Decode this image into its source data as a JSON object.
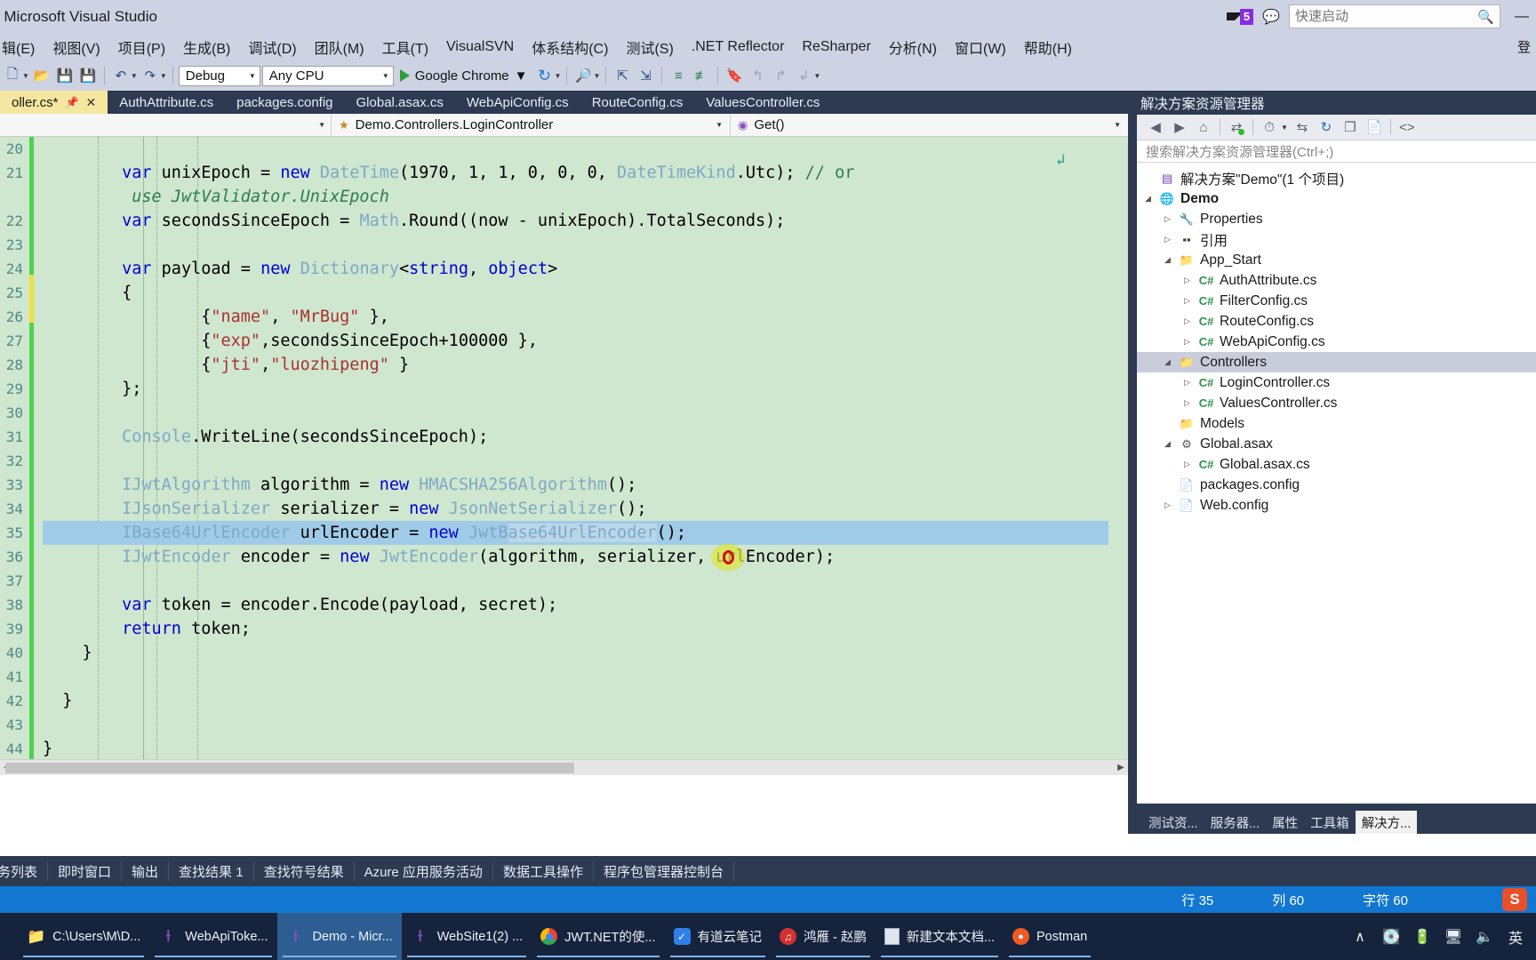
{
  "titlebar": {
    "title": "- Microsoft Visual Studio",
    "quick_launch_placeholder": "快速启动",
    "notification_count": "5",
    "filter_icon": "funnel-icon",
    "feedback_icon": "feedback-icon",
    "search_icon": "search-icon",
    "minimize": "—"
  },
  "menubar": {
    "items": [
      "辑(E)",
      "视图(V)",
      "项目(P)",
      "生成(B)",
      "调试(D)",
      "团队(M)",
      "工具(T)",
      "VisualSVN",
      "体系结构(C)",
      "测试(S)",
      ".NET Reflector",
      "ReSharper",
      "分析(N)",
      "窗口(W)",
      "帮助(H)"
    ],
    "signin": "登"
  },
  "toolbar": {
    "config_value": "Debug",
    "platform_value": "Any CPU",
    "run_label": "Google Chrome",
    "icons": [
      "new-project-icon",
      "open-file-icon",
      "save-icon",
      "save-all-icon",
      "undo-icon",
      "redo-icon",
      "find-icon",
      "navigate-backward-icon",
      "navigate-forward-icon",
      "comment-icon",
      "uncomment-icon",
      "bookmark-icon",
      "prev-bookmark-icon",
      "next-bookmark-icon",
      "clear-bookmark-icon"
    ]
  },
  "editor_tabs": [
    {
      "label": "oller.cs*",
      "active": true,
      "pinned": true,
      "closable": true
    },
    {
      "label": "AuthAttribute.cs",
      "active": false
    },
    {
      "label": "packages.config",
      "active": false
    },
    {
      "label": "Global.asax.cs",
      "active": false
    },
    {
      "label": "WebApiConfig.cs",
      "active": false
    },
    {
      "label": "RouteConfig.cs",
      "active": false
    },
    {
      "label": "ValuesController.cs",
      "active": false
    }
  ],
  "navbar": {
    "type_scope": "Demo.Controllers.LoginController",
    "member_scope": "Get()"
  },
  "code": {
    "first_line_number": 20,
    "selected_line_index": 16,
    "lines": [
      {
        "n": "20",
        "html": ""
      },
      {
        "n": "21",
        "html": "        <span class='kw'>var</span> unixEpoch = <span class='kw'>new</span> <span class='ty'>DateTime</span>(1970, 1, 1, 0, 0, 0, <span class='ty'>DateTimeKind</span>.Utc); <span class='cmt'>// or</span>"
      },
      {
        "n": "",
        "html": "         <span class='cmt-i'>use JwtValidator.UnixEpoch</span>"
      },
      {
        "n": "22",
        "html": "        <span class='kw'>var</span> secondsSinceEpoch = <span class='ty'>Math</span>.Round((now - unixEpoch).TotalSeconds);"
      },
      {
        "n": "23",
        "html": ""
      },
      {
        "n": "24",
        "html": "        <span class='kw'>var</span> payload = <span class='kw'>new</span> <span class='ty'>Dictionary</span>&lt;<span class='kw'>string</span>, <span class='kw'>object</span>&gt;"
      },
      {
        "n": "25",
        "html": "        {"
      },
      {
        "n": "26",
        "html": "                {<span class='str'>\"name\"</span>, <span class='str'>\"MrBug\"</span> },"
      },
      {
        "n": "27",
        "html": "                {<span class='str'>\"exp\"</span>,secondsSinceEpoch+100000 },"
      },
      {
        "n": "28",
        "html": "                {<span class='str'>\"jti\"</span>,<span class='str'>\"luozhipeng\"</span> }"
      },
      {
        "n": "29",
        "html": "        };"
      },
      {
        "n": "30",
        "html": ""
      },
      {
        "n": "31",
        "html": "        <span class='ty'>Console</span>.WriteLine(secondsSinceEpoch);"
      },
      {
        "n": "32",
        "html": ""
      },
      {
        "n": "33",
        "html": "        <span class='ty'>IJwtAlgorithm</span> algorithm = <span class='kw'>new</span> <span class='ty'>HMACSHA256Algorithm</span>();"
      },
      {
        "n": "34",
        "html": "        <span class='ty'>IJsonSerializer</span> serializer = <span class='kw'>new</span> <span class='ty'>JsonNetSerializer</span>();"
      },
      {
        "n": "35",
        "html": "        <span class='ty'>IBase64UrlEncoder</span> urlEncoder = <span class='kw'>new</span> <span class='ty'>JwtB</span><span class='hl-word'><span class='ty'>ase64Url</span></span><span class='hl-word'><span class='ty'>Encoder</span></span>();"
      },
      {
        "n": "36",
        "html": "        <span class='ty'>IJwtEncoder</span> encoder = <span class='kw'>new</span> <span class='ty'>JwtEncoder</span>(algorithm, serializer, urlEncoder);"
      },
      {
        "n": "37",
        "html": ""
      },
      {
        "n": "38",
        "html": "        <span class='kw'>var</span> token = encoder.Encode(payload, secret);"
      },
      {
        "n": "39",
        "html": "        <span class='kw'>return</span> token;"
      },
      {
        "n": "40",
        "html": "    }"
      },
      {
        "n": "41",
        "html": ""
      },
      {
        "n": "42",
        "html": "  }"
      },
      {
        "n": "43",
        "html": ""
      },
      {
        "n": "44",
        "html": "}"
      }
    ]
  },
  "solution_explorer": {
    "title": "解决方案资源管理器",
    "search_placeholder": "搜索解决方案资源管理器(Ctrl+;)",
    "toolbar_icons": [
      "back-icon",
      "forward-icon",
      "home-icon",
      "sync-with-active-document-icon",
      "pending-changes-icon",
      "toggle-icon",
      "refresh-icon",
      "collapse-all-icon",
      "show-all-files-icon",
      "view-code-icon"
    ],
    "tree": [
      {
        "depth": 0,
        "twisty": "",
        "icon": "solution-icon",
        "label": "解决方案\"Demo\"(1 个项目)",
        "bold": false,
        "selected": false
      },
      {
        "depth": 0,
        "twisty": "▲",
        "icon": "project-icon",
        "label": "Demo",
        "bold": true,
        "selected": false
      },
      {
        "depth": 1,
        "twisty": "▶",
        "icon": "properties-icon",
        "label": "Properties",
        "bold": false,
        "selected": false
      },
      {
        "depth": 1,
        "twisty": "▶",
        "icon": "references-icon",
        "label": "引用",
        "bold": false,
        "selected": false
      },
      {
        "depth": 1,
        "twisty": "▲",
        "icon": "folder-icon",
        "label": "App_Start",
        "bold": false,
        "selected": false
      },
      {
        "depth": 2,
        "twisty": "▶",
        "icon": "csharp-file-icon",
        "label": "AuthAttribute.cs",
        "bold": false,
        "selected": false
      },
      {
        "depth": 2,
        "twisty": "▶",
        "icon": "csharp-file-icon",
        "label": "FilterConfig.cs",
        "bold": false,
        "selected": false
      },
      {
        "depth": 2,
        "twisty": "▶",
        "icon": "csharp-file-icon",
        "label": "RouteConfig.cs",
        "bold": false,
        "selected": false
      },
      {
        "depth": 2,
        "twisty": "▶",
        "icon": "csharp-file-icon",
        "label": "WebApiConfig.cs",
        "bold": false,
        "selected": false
      },
      {
        "depth": 1,
        "twisty": "▲",
        "icon": "folder-icon",
        "label": "Controllers",
        "bold": false,
        "selected": true
      },
      {
        "depth": 2,
        "twisty": "▶",
        "icon": "csharp-file-icon",
        "label": "LoginController.cs",
        "bold": false,
        "selected": false
      },
      {
        "depth": 2,
        "twisty": "▶",
        "icon": "csharp-file-icon",
        "label": "ValuesController.cs",
        "bold": false,
        "selected": false
      },
      {
        "depth": 1,
        "twisty": "",
        "icon": "folder-icon",
        "label": "Models",
        "bold": false,
        "selected": false
      },
      {
        "depth": 1,
        "twisty": "▲",
        "icon": "asax-icon",
        "label": "Global.asax",
        "bold": false,
        "selected": false
      },
      {
        "depth": 2,
        "twisty": "▶",
        "icon": "csharp-file-icon",
        "label": "Global.asax.cs",
        "bold": false,
        "selected": false
      },
      {
        "depth": 1,
        "twisty": "",
        "icon": "config-icon",
        "label": "packages.config",
        "bold": false,
        "selected": false
      },
      {
        "depth": 1,
        "twisty": "▶",
        "icon": "config-icon",
        "label": "Web.config",
        "bold": false,
        "selected": false
      }
    ],
    "bottom_tabs": [
      {
        "label": "测试资...",
        "active": false
      },
      {
        "label": "服务器...",
        "active": false
      },
      {
        "label": "属性",
        "active": false
      },
      {
        "label": "工具箱",
        "active": false
      },
      {
        "label": "解决方...",
        "active": true
      }
    ]
  },
  "dock_tabs": [
    "务列表",
    "即时窗口",
    "输出",
    "查找结果 1",
    "查找符号结果",
    "Azure 应用服务活动",
    "数据工具操作",
    "程序包管理器控制台"
  ],
  "statusbar": {
    "line_label": "行 35",
    "col_label": "列 60",
    "char_label": "字符 60",
    "logo": "S"
  },
  "taskbar": {
    "items": [
      {
        "label": "C:\\Users\\M\\D...",
        "icon": "folder-icon",
        "active": false
      },
      {
        "label": "WebApiToke...",
        "icon": "visual-studio-icon",
        "active": false
      },
      {
        "label": "Demo - Micr...",
        "icon": "visual-studio-icon",
        "active": true
      },
      {
        "label": "WebSite1(2) ...",
        "icon": "visual-studio-icon",
        "active": false
      },
      {
        "label": "JWT.NET的使...",
        "icon": "chrome-icon",
        "active": false
      },
      {
        "label": "有道云笔记",
        "icon": "youdao-icon",
        "active": false
      },
      {
        "label": "鸿雁 - 赵鹏",
        "icon": "netease-music-icon",
        "active": false
      },
      {
        "label": "新建文本文档...",
        "icon": "notepad-icon",
        "active": false
      },
      {
        "label": "Postman",
        "icon": "postman-icon",
        "active": false
      }
    ],
    "tray": [
      "∧",
      "usb-icon",
      "battery-icon",
      "network-icon",
      "volume-icon",
      "英"
    ]
  },
  "colors": {
    "title_bg": "#cdd3e3",
    "tab_active": "#f5e6a0",
    "editor_bg": "#cfe6cf",
    "selection": "#9fcbe8",
    "status_blue": "#1177d1",
    "panel_dark": "#2d3a52",
    "taskbar": "#16233c"
  }
}
